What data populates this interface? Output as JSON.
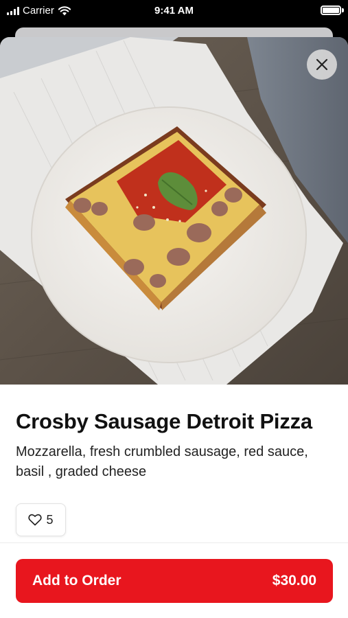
{
  "status_bar": {
    "carrier": "Carrier",
    "time": "9:41 AM"
  },
  "item": {
    "name": "Crosby Sausage Detroit Pizza",
    "description": "Mozzarella, fresh crumbled sausage, red sauce, basil , graded cheese",
    "likes": "5"
  },
  "order_button": {
    "label": "Add to Order",
    "price": "$30.00"
  },
  "icons": {
    "close": "close-icon",
    "like": "heart-outline-icon"
  },
  "colors": {
    "accent": "#e8161e",
    "text": "#111111"
  }
}
